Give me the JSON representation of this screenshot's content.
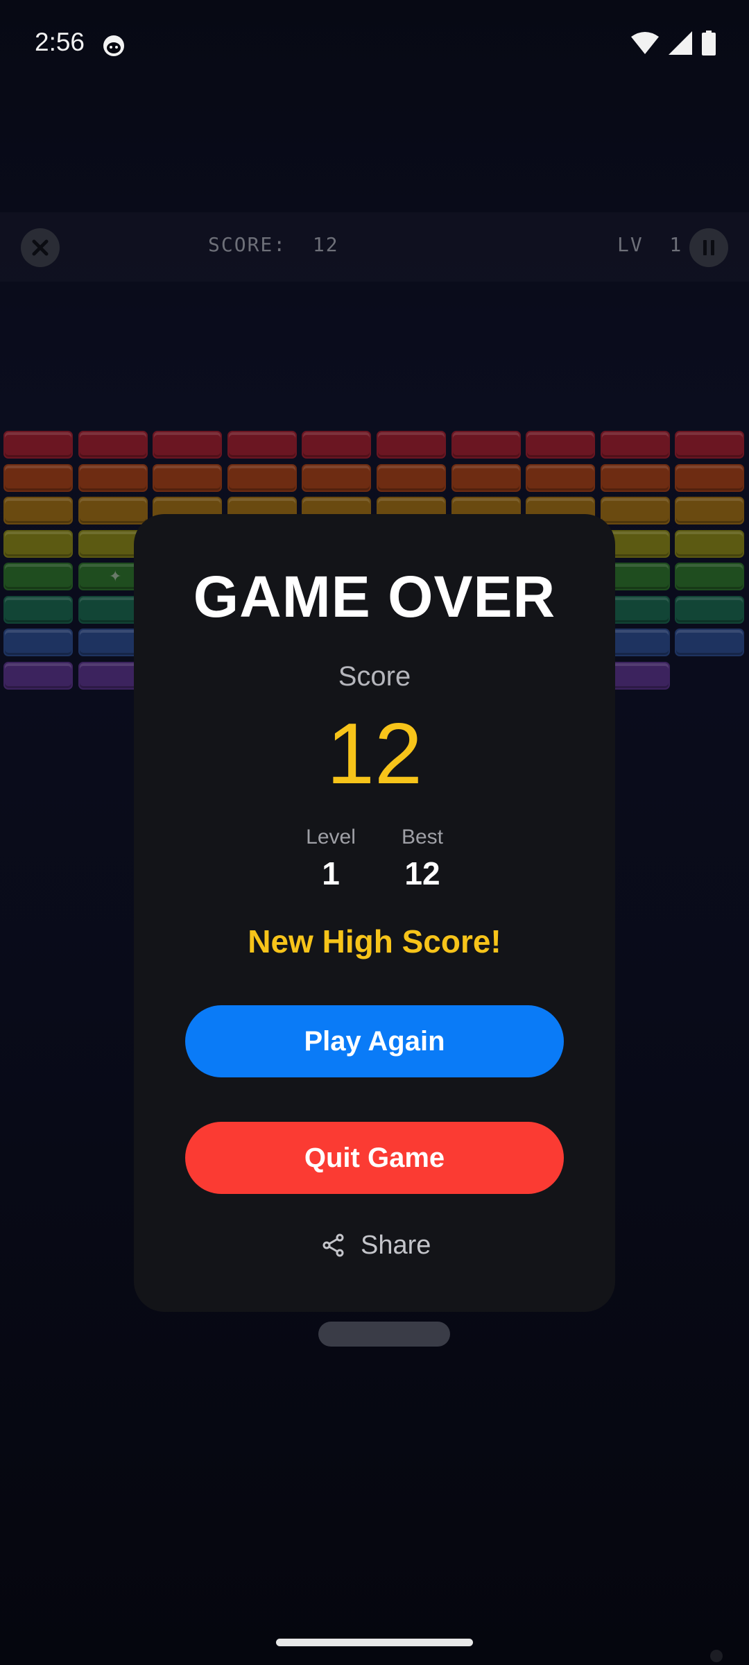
{
  "status_bar": {
    "time": "2:56"
  },
  "hud": {
    "score_text": "SCORE:  12",
    "level_text": "LV  1"
  },
  "modal": {
    "title": "GAME OVER",
    "score_label": "Score",
    "score_value": "12",
    "level_label": "Level",
    "level_value": "1",
    "best_label": "Best",
    "best_value": "12",
    "new_high_score": "New High Score!",
    "play_again": "Play Again",
    "quit_game": "Quit Game",
    "share": "Share"
  },
  "bricks": {
    "columns": 10,
    "rows": [
      {
        "color": "#6b1622",
        "count": 10
      },
      {
        "color": "#6e2c12",
        "count": 10
      },
      {
        "color": "#6a4a10",
        "count": 10
      },
      {
        "color": "#5c5a12",
        "count": 10
      },
      {
        "color": "#1f4d1f",
        "count": 10
      },
      {
        "color": "#124536",
        "count": 10
      },
      {
        "color": "#1e3360",
        "count": 10
      },
      {
        "color": "#3c235e",
        "count": 9
      }
    ]
  },
  "colors": {
    "accent_yellow": "#f7c41a",
    "play_button": "#0a7bf7",
    "quit_button": "#fb3b33",
    "modal_bg": "#131418"
  },
  "icons": [
    "cat-notification-icon",
    "wifi-icon",
    "signal-icon",
    "battery-icon",
    "close-icon",
    "pause-icon",
    "ball-icon",
    "share-icon"
  ]
}
